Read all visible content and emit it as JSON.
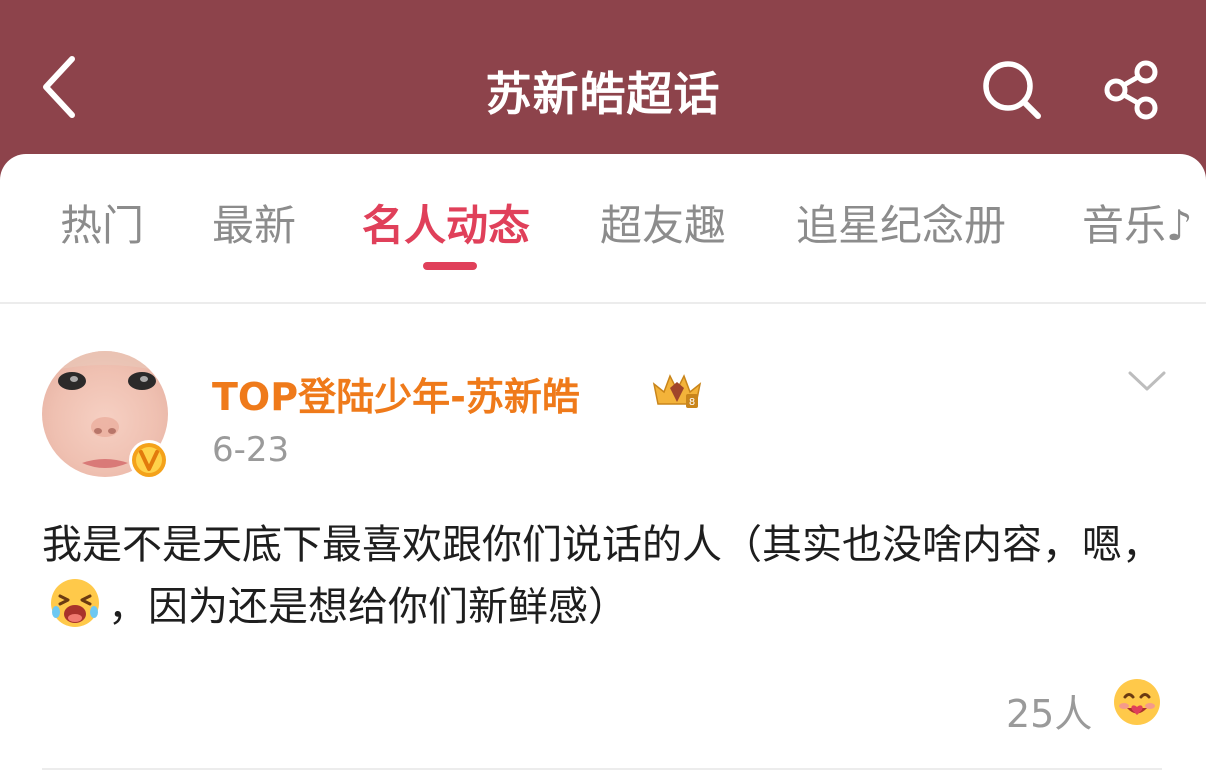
{
  "header": {
    "title": "苏新皓超话",
    "back_icon": "chevron-left-icon",
    "search_icon": "search-icon",
    "share_icon": "share-icon",
    "background": "#8d434b"
  },
  "tabs": [
    {
      "label": "热门",
      "active": false
    },
    {
      "label": "最新",
      "active": false
    },
    {
      "label": "名人动态",
      "active": true
    },
    {
      "label": "超友趣",
      "active": false
    },
    {
      "label": "追星纪念册",
      "active": false
    },
    {
      "label": "音乐♪",
      "active": false
    }
  ],
  "accent_color": "#e0405a",
  "post": {
    "username": "TOP登陆少年-苏新皓",
    "username_color": "#ef7a1a",
    "verified_icon": "verified-v-badge-icon",
    "rank_icon": "crown-badge-icon",
    "date": "6-23",
    "text_part1": "我是不是天底下最喜欢跟你们说话的人（其实也没啥内容，嗯，",
    "inline_emoji": "laughing-crying-emoji-icon",
    "text_part2": "，因为还是想给你们新鲜感）",
    "likes_count": "25人",
    "like_emoji": "love-emoji-icon",
    "more_icon": "chevron-down-icon"
  }
}
